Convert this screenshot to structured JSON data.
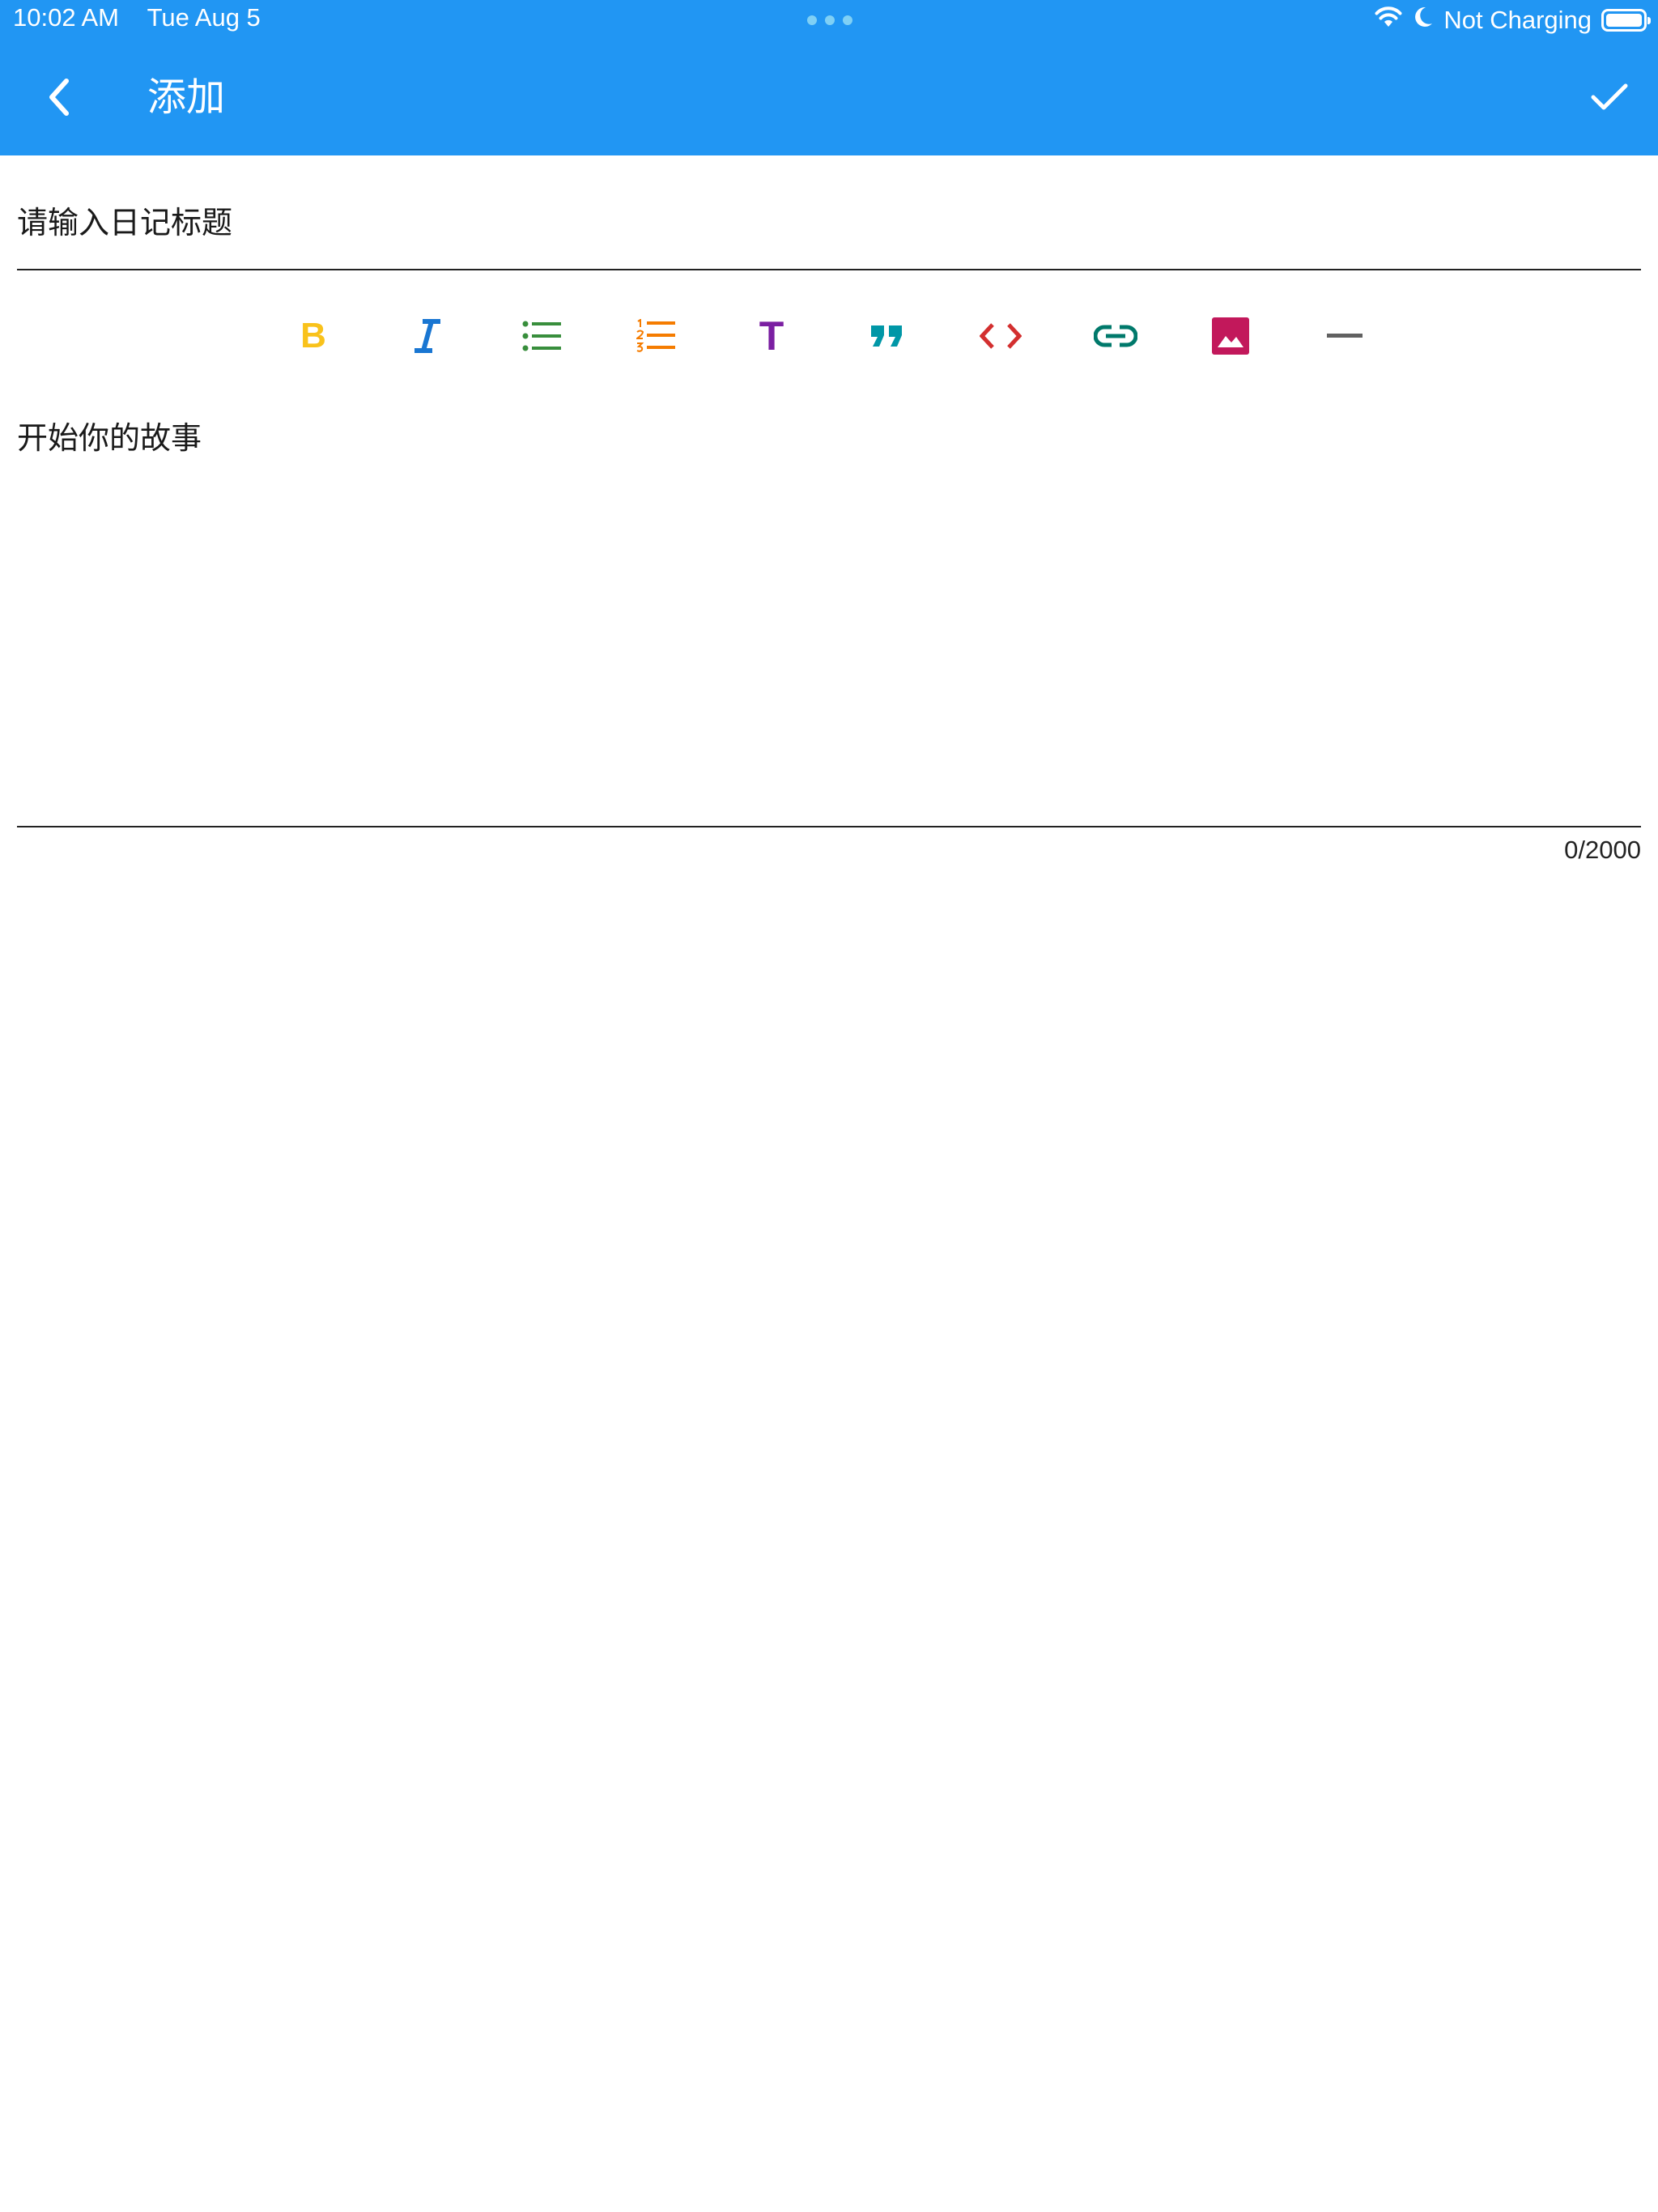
{
  "status_bar": {
    "time": "10:02 AM",
    "date": "Tue Aug 5",
    "battery_text": "Not Charging",
    "icons": [
      "wifi-icon",
      "moon-icon",
      "battery-icon"
    ]
  },
  "app_bar": {
    "title": "添加",
    "back_icon": "chevron-left-icon",
    "confirm_icon": "check-icon",
    "background_color": "#2196F3"
  },
  "title_input": {
    "value": "",
    "placeholder": "请输入日记标题"
  },
  "toolbar": {
    "bold_label": "B",
    "heading_label": "T",
    "tools": [
      {
        "name": "bold",
        "icon": "bold-icon",
        "color": "#F9C21B"
      },
      {
        "name": "italic",
        "icon": "italic-icon",
        "color": "#1976D2"
      },
      {
        "name": "unordered-list",
        "icon": "bulleted-list-icon",
        "color": "#388E3C"
      },
      {
        "name": "ordered-list",
        "icon": "numbered-list-icon",
        "color": "#F57C00"
      },
      {
        "name": "heading",
        "icon": "heading-icon",
        "color": "#7B1FA2"
      },
      {
        "name": "quote",
        "icon": "quote-icon",
        "color": "#0097A7"
      },
      {
        "name": "code",
        "icon": "code-icon",
        "color": "#D32F2F"
      },
      {
        "name": "link",
        "icon": "link-icon",
        "color": "#00796B"
      },
      {
        "name": "image",
        "icon": "image-icon",
        "color": "#C2185B"
      },
      {
        "name": "horizontal-rule",
        "icon": "horizontal-rule-icon",
        "color": "#616161"
      }
    ]
  },
  "body_input": {
    "value": "",
    "placeholder": "开始你的故事"
  },
  "counter": {
    "text": "0/2000"
  }
}
